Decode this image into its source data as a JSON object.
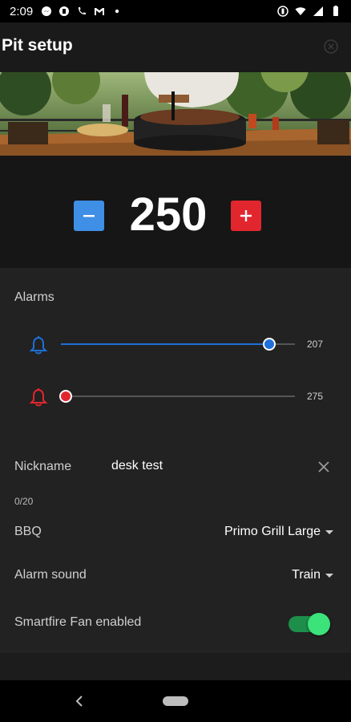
{
  "status_bar": {
    "time": "2:09",
    "icons_left": [
      "messenger-icon",
      "app-icon",
      "phone-wifi-icon",
      "gmail-icon",
      "dot-icon"
    ],
    "icons_right": [
      "vibrate-icon",
      "wifi-icon",
      "signal-icon",
      "battery-icon"
    ]
  },
  "header": {
    "title": "Pit setup",
    "close_icon": "close-circle-icon"
  },
  "hero": {
    "image": "grill-on-patio-photo"
  },
  "temperature": {
    "value": "250",
    "minus_color": "#3f8fe6",
    "plus_color": "#e2262e"
  },
  "alarms": {
    "title": "Alarms",
    "high": {
      "value": "207",
      "icon": "bell-icon",
      "color": "#1e6fd9",
      "level": 0.89
    },
    "low": {
      "value": "275",
      "icon": "bell-icon",
      "color": "#e2262e",
      "level": 0.02
    }
  },
  "nickname": {
    "label": "Nickname",
    "value": "desk test",
    "counter": "0/20"
  },
  "bbq": {
    "label": "BBQ",
    "selected": "Primo Grill Large"
  },
  "alarm_sound": {
    "label": "Alarm sound",
    "selected": "Train"
  },
  "smartfire": {
    "label": "Smartfire Fan enabled",
    "enabled": true,
    "accent": "#3ce27a"
  }
}
